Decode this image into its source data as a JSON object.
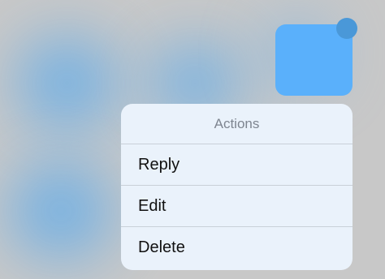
{
  "menu": {
    "title": "Actions",
    "items": [
      {
        "label": "Reply"
      },
      {
        "label": "Edit"
      },
      {
        "label": "Delete"
      }
    ]
  },
  "colors": {
    "tile": "#5ab0fb",
    "badge": "#4a98d8",
    "menu_background": "#eaf2fb",
    "separator": "#c9d0d8"
  }
}
